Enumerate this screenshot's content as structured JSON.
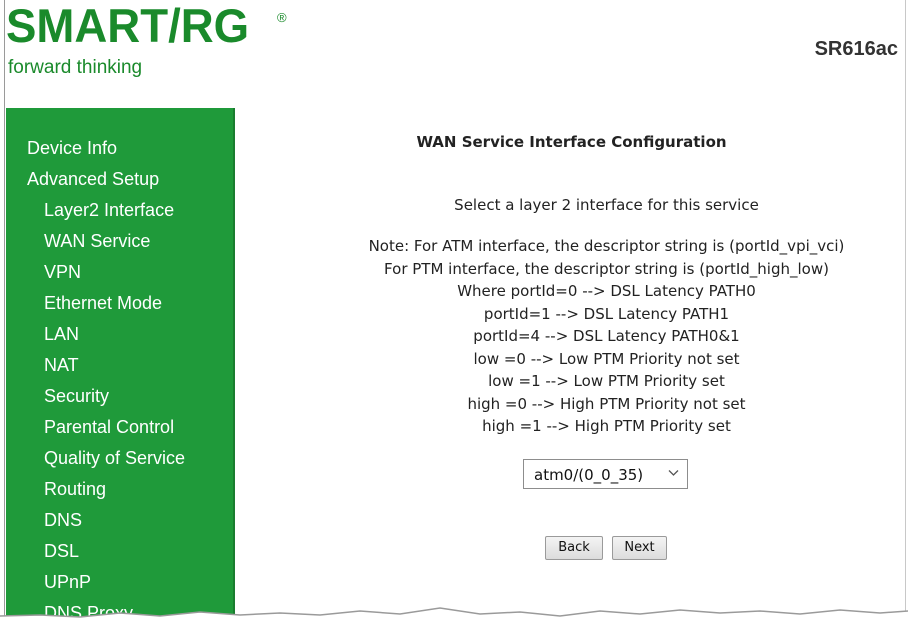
{
  "header": {
    "logo": "SMART/RG",
    "logo_mark": "®",
    "tagline": "forward thinking",
    "model": "SR616ac"
  },
  "sidebar": {
    "items": [
      {
        "label": "Device Info",
        "level": 0
      },
      {
        "label": "Advanced Setup",
        "level": 0
      },
      {
        "label": "Layer2 Interface",
        "level": 1
      },
      {
        "label": "WAN Service",
        "level": 1
      },
      {
        "label": "VPN",
        "level": 1
      },
      {
        "label": "Ethernet Mode",
        "level": 1
      },
      {
        "label": "LAN",
        "level": 1
      },
      {
        "label": "NAT",
        "level": 1
      },
      {
        "label": "Security",
        "level": 1
      },
      {
        "label": "Parental Control",
        "level": 1
      },
      {
        "label": "Quality of Service",
        "level": 1
      },
      {
        "label": "Routing",
        "level": 1
      },
      {
        "label": "DNS",
        "level": 1
      },
      {
        "label": "DSL",
        "level": 1
      },
      {
        "label": "UPnP",
        "level": 1
      },
      {
        "label": "DNS Proxy",
        "level": 1
      }
    ]
  },
  "main": {
    "title": "WAN Service Interface Configuration",
    "subtitle": "Select a layer 2 interface for this service",
    "note_lines": [
      "Note: For ATM interface, the descriptor string is (portId_vpi_vci)",
      "For PTM interface, the descriptor string is (portId_high_low)",
      "Where portId=0 --> DSL Latency PATH0",
      "portId=1 --> DSL Latency PATH1",
      "portId=4 --> DSL Latency PATH0&1",
      "low =0 --> Low PTM Priority not set",
      "low =1 --> Low PTM Priority set",
      "high =0 --> High PTM Priority not set",
      "high =1 --> High PTM Priority set"
    ],
    "interface_select": {
      "value": "atm0/(0_0_35)"
    },
    "back_label": "Back",
    "next_label": "Next"
  },
  "colors": {
    "brand_green": "#1a8a2b",
    "sidebar_green": "#1f9a3a"
  }
}
